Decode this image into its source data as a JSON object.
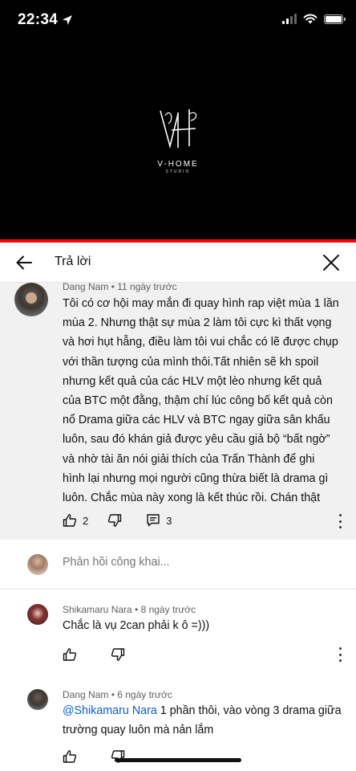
{
  "status_bar": {
    "time": "22:34",
    "location_icon": "location-arrow-icon",
    "signal_icon": "cellular-signal-icon",
    "wifi_icon": "wifi-icon",
    "battery_icon": "battery-icon"
  },
  "video": {
    "logo_text": "V-HOME",
    "logo_sub": "STUDIO",
    "progress_fraction": 1.0
  },
  "header": {
    "title": "Trả lời",
    "back_icon": "arrow-left-icon",
    "close_icon": "close-icon"
  },
  "main_comment": {
    "author": "Dang Nam",
    "time": "11 ngày trước",
    "text": "Tôi có cơ hội may mắn đi quay hình rap việt mùa 1 lần mùa 2. Nhưng thật sự mùa 2 làm tôi cực kì thất vọng và hơi hụt hẫng, điều làm tôi vui chắc có lẽ được chụp với thần tượng của mình thôi.Tất nhiên sẽ kh spoil nhưng kết quả của các HLV một lèo nhưng kết quả của BTC một đằng, thậm chí lúc công bố kết quả còn nổ Drama giữa các HLV và BTC ngay giữa sân khấu luôn, sau đó khán giả được  yêu cầu  giả bộ “bất ngờ” và nhờ tài ăn nói giải thích của Trấn Thành để ghi hình lại nhưng mọi người cũng thừa biết là drama gì luôn.  Chắc mùa này xong là kết thúc rồi. Chán thật",
    "likes": "2",
    "replies": "3"
  },
  "reply_input": {
    "placeholder": "Phản hồi công khai..."
  },
  "replies": [
    {
      "author": "Shikamaru Nara",
      "time": "8 ngày trước",
      "text": "Chắc là vụ 2can phải k ô =)))"
    },
    {
      "author": "Dang Nam",
      "time": "6 ngày trước",
      "mention": "@Shikamaru Nara",
      "text": " 1 phần thôi, vào vòng 3 drama giữa trường quay luôn mà nản lắm"
    }
  ],
  "separator": " • ",
  "colors": {
    "accent_red": "#ff0000",
    "mention_blue": "#065fd4",
    "meta_gray": "#606060",
    "highlight_bg": "#f1f1f1"
  }
}
